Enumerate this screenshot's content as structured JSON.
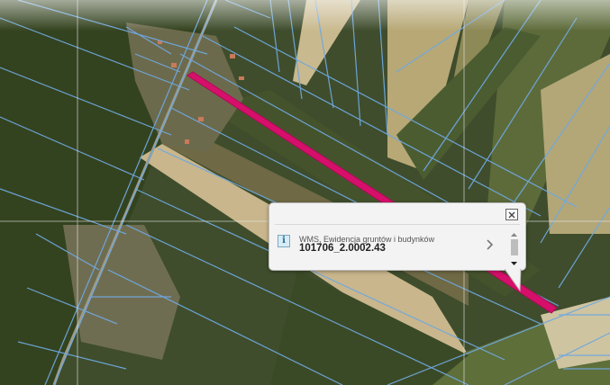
{
  "map": {
    "highlight_color": "#d6106a",
    "parcel_line_color": "#6fa8e0",
    "graticule_color": "#e9e9e9"
  },
  "popup": {
    "layer_name": "WMS, Ewidencja gruntów i budynków",
    "feature_id": "101706_2.0002.43",
    "info_icon_char": "i",
    "close_icon": "close-icon",
    "next_icon": "chevron-right-icon"
  }
}
